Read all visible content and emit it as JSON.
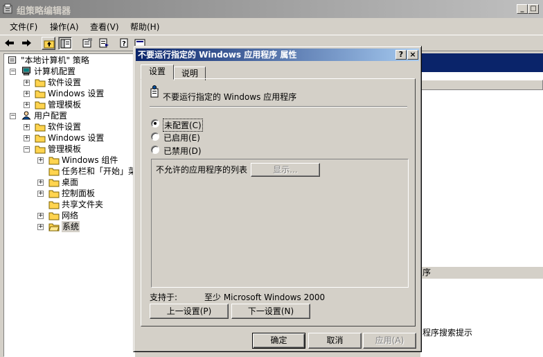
{
  "main_window": {
    "title": "组策略编辑器",
    "menu": [
      "文件(F)",
      "操作(A)",
      "查看(V)",
      "帮助(H)"
    ]
  },
  "tree": {
    "root": "\"本地计算机\" 策略",
    "items": [
      {
        "label": "计算机配置"
      },
      {
        "label": "软件设置"
      },
      {
        "label": "Windows 设置"
      },
      {
        "label": "管理模板"
      },
      {
        "label": "用户配置"
      },
      {
        "label": "软件设置"
      },
      {
        "label": "Windows 设置"
      },
      {
        "label": "管理模板"
      },
      {
        "label": "Windows 组件"
      },
      {
        "label": "任务栏和「开始」菜"
      },
      {
        "label": "桌面"
      },
      {
        "label": "控制面板"
      },
      {
        "label": "共享文件夹"
      },
      {
        "label": "网络"
      },
      {
        "label": "系统"
      }
    ]
  },
  "right_pane": {
    "col_label": "序",
    "text": "程序搜索提示"
  },
  "dialog": {
    "title": "不要运行指定的 Windows 应用程序 属性",
    "help_btn": "?",
    "close_btn": "×",
    "tabs": [
      "设置",
      "说明"
    ],
    "setting_name": "不要运行指定的 Windows 应用程序",
    "options": [
      "未配置(C)",
      "已启用(E)",
      "已禁用(D)"
    ],
    "selected_option": "未配置(C)",
    "list_label": "不允许的应用程序的列表",
    "show_button": "显示...",
    "supported_label": "支持于:",
    "supported_value": "至少 Microsoft Windows 2000",
    "prev_button": "上一设置(P)",
    "next_button": "下一设置(N)",
    "ok_button": "确定",
    "cancel_button": "取消",
    "apply_button": "应用(A)"
  }
}
